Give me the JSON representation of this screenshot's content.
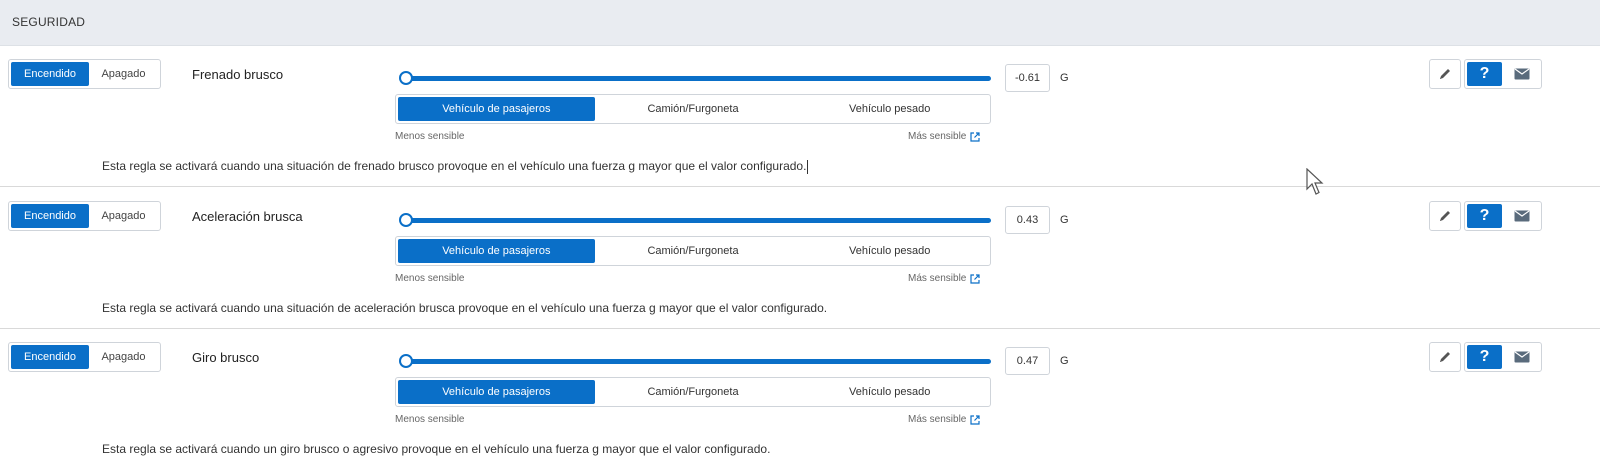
{
  "section": {
    "title": "SEGURIDAD"
  },
  "colors": {
    "accent": "#0a6fc8",
    "header_bg": "#e9ecf1"
  },
  "common": {
    "toggle_on": "Encendido",
    "toggle_off": "Apagado",
    "vehicle_types": [
      "Vehículo de pasajeros",
      "Camión/Furgoneta",
      "Vehículo pesado"
    ],
    "less_sensitive": "Menos sensible",
    "more_sensitive": "Más sensible",
    "unit": "G",
    "help_label": "?"
  },
  "rules": [
    {
      "name": "Frenado brusco",
      "value": "-0.61",
      "slider_fraction": 0.0,
      "selected_vehicle": "Vehículo de pasajeros",
      "description": "Esta regla se activará cuando una situación de frenado brusco provoque en el vehículo una fuerza g mayor que el valor configurado."
    },
    {
      "name": "Aceleración brusca",
      "value": "0.43",
      "slider_fraction": 0.0,
      "selected_vehicle": "Vehículo de pasajeros",
      "description": "Esta regla se activará cuando una situación de aceleración brusca provoque en el vehículo una fuerza g mayor que el valor configurado."
    },
    {
      "name": "Giro brusco",
      "value": "0.47",
      "slider_fraction": 0.0,
      "selected_vehicle": "Vehículo de pasajeros",
      "description": "Esta regla se activará cuando un giro brusco o agresivo provoque en el vehículo una fuerza g mayor que el valor configurado."
    }
  ],
  "icons": [
    "pencil-icon",
    "help-icon",
    "envelope-icon",
    "external-link-icon",
    "mouse-cursor-icon"
  ]
}
